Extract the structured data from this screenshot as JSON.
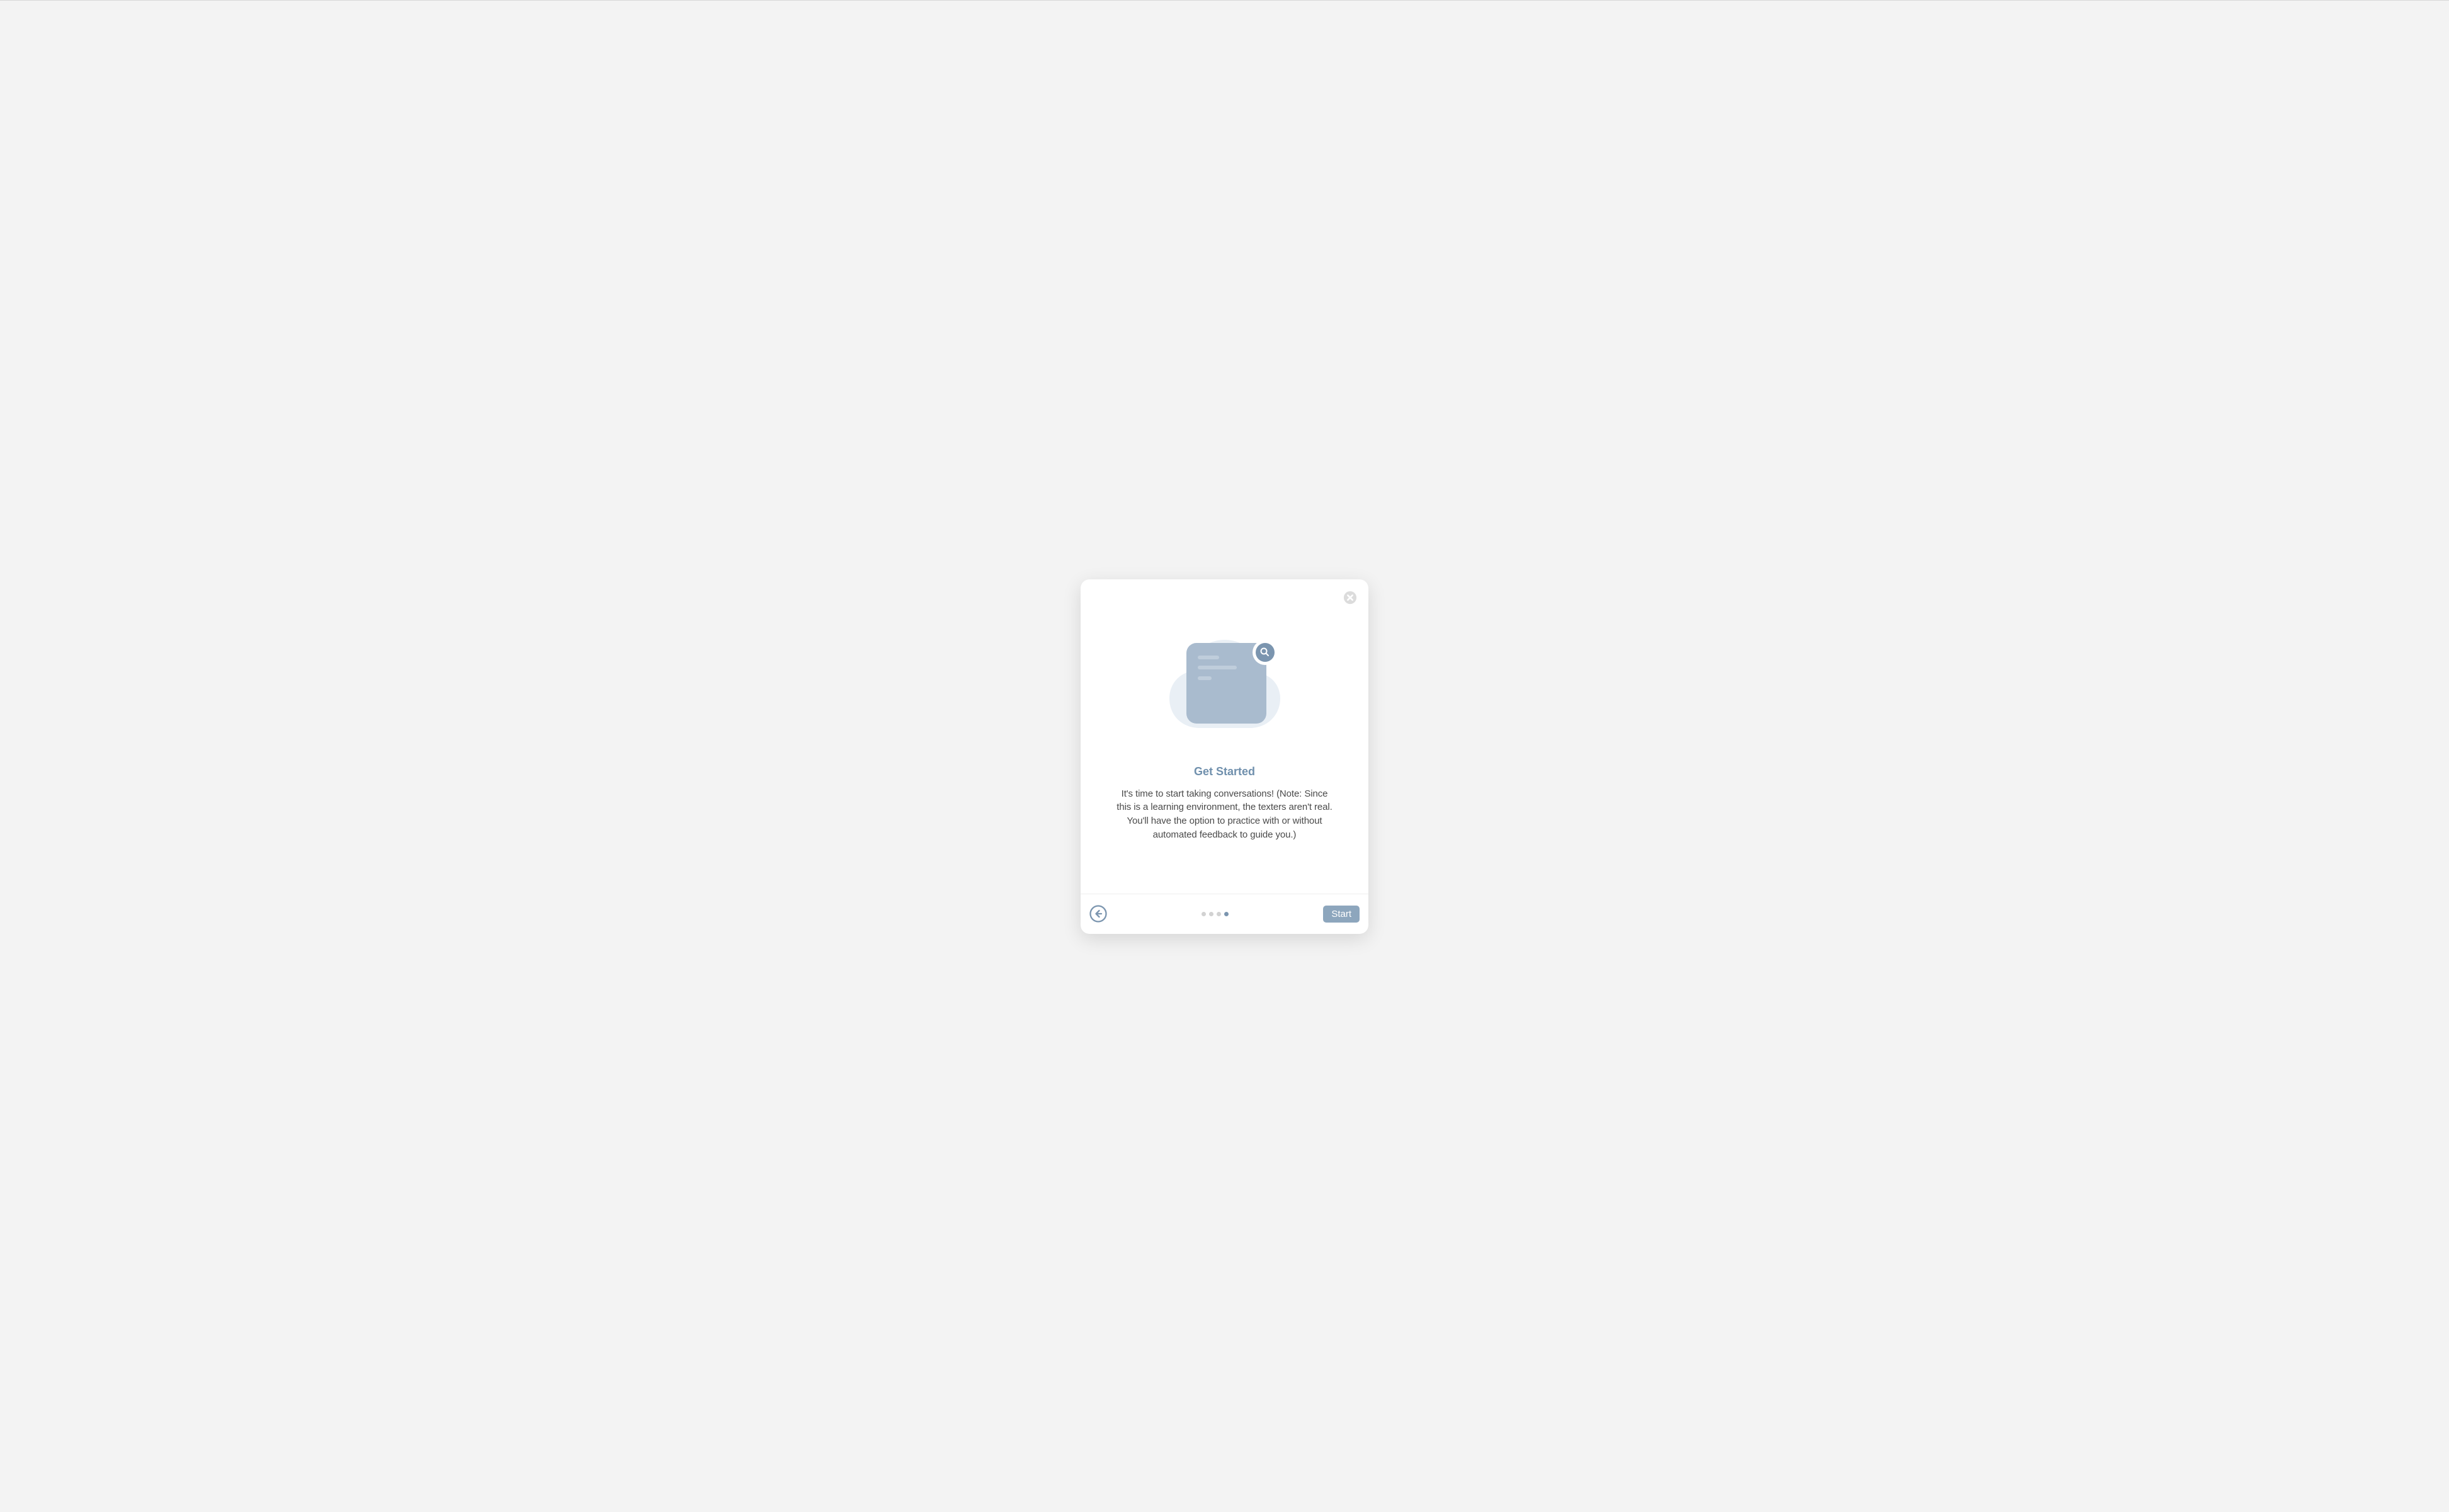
{
  "modal": {
    "heading": "Get Started",
    "body": "It's time to start taking conversations! (Note: Since this is a learning environment, the texters aren't real. You'll have the option to practice with or without automated feedback to guide you.)",
    "start_label": "Start",
    "pagination": {
      "total": 4,
      "current": 4
    }
  },
  "icons": {
    "close": "close-icon",
    "back": "arrow-left-circle-icon",
    "search": "search-icon"
  },
  "colors": {
    "accent": "#7b95af",
    "heading": "#7090ad",
    "button_bg": "#8da6bd",
    "illustration_card": "#a9bbce",
    "dot_inactive": "#d2d2d2"
  }
}
